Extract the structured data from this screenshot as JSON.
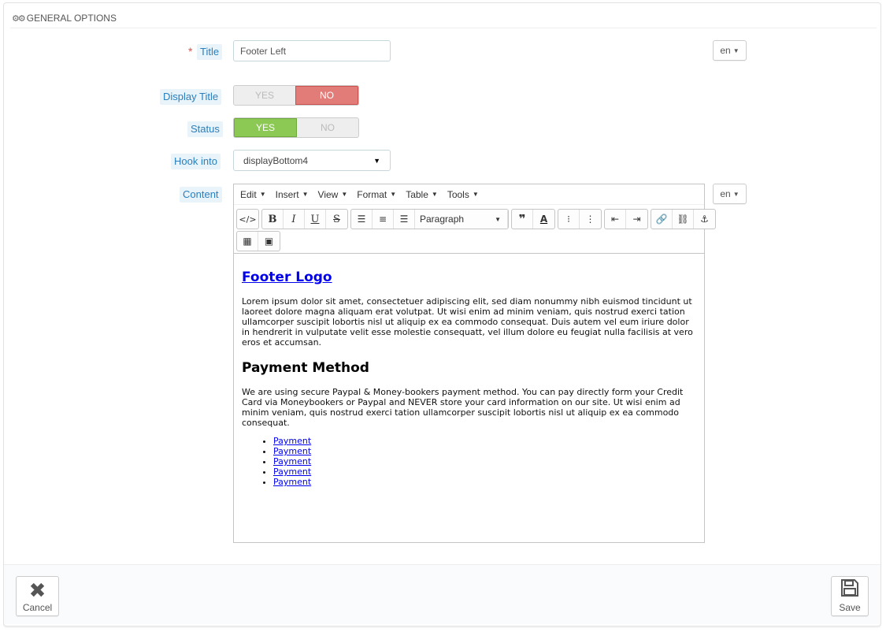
{
  "panel": {
    "heading": "General options",
    "heading_icon": "gears-icon"
  },
  "form": {
    "title": {
      "label": "Title",
      "required_mark": "*",
      "value": "Footer Left",
      "lang": "en"
    },
    "display_title": {
      "label": "Display Title",
      "yes": "YES",
      "no": "NO",
      "selected": "NO"
    },
    "status": {
      "label": "Status",
      "yes": "YES",
      "no": "NO",
      "selected": "YES"
    },
    "hook_into": {
      "label": "Hook into",
      "value": "displayBottom4"
    },
    "content": {
      "label": "Content",
      "lang": "en"
    }
  },
  "editor": {
    "menu": [
      "Edit",
      "Insert",
      "View",
      "Format",
      "Table",
      "Tools"
    ],
    "format_select": "Paragraph",
    "body": {
      "heading1": "Footer Logo",
      "paragraph1": "Lorem ipsum dolor sit amet, consectetuer adipiscing elit, sed diam nonummy nibh euismod tincidunt ut laoreet dolore magna aliquam erat volutpat. Ut wisi enim ad minim veniam, quis nostrud exerci tation ullamcorper suscipit lobortis nisl ut aliquip ex ea commodo consequat. Duis autem vel eum iriure dolor in hendrerit in vulputate velit esse molestie consequatt, vel illum dolore eu feugiat nulla facilisis at vero eros et accumsan.",
      "heading2": "Payment Method",
      "paragraph2": "We are using secure Paypal & Money-bookers payment method. You can pay directly form your Credit Card via Moneybookers or Paypal and NEVER store your card information on our site. Ut wisi enim ad minim veniam, quis nostrud exerci tation ullamcorper suscipit lobortis nisl ut aliquip ex ea commodo consequat.",
      "links": [
        "Payment",
        "Payment",
        "Payment",
        "Payment",
        "Payment"
      ]
    }
  },
  "footer": {
    "cancel": "Cancel",
    "save": "Save"
  },
  "colors": {
    "label_text": "#2a7fbc",
    "switch_no_active": "#e27c79",
    "switch_yes_active": "#8bc954",
    "link": "#0000ee"
  }
}
